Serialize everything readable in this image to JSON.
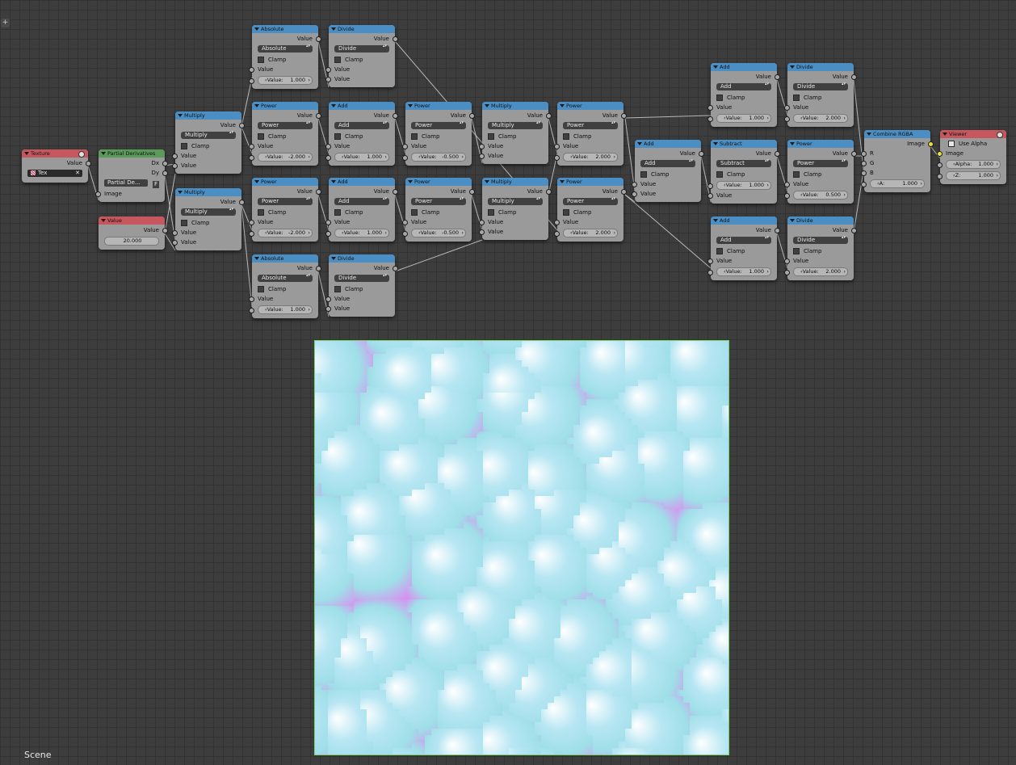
{
  "editor": {
    "add_button": "+",
    "scene_label": "Scene"
  },
  "nodes": {
    "texture": {
      "title": "Texture",
      "out_value": "Value",
      "tex_name": "Tex",
      "tex_clear": "✕"
    },
    "partial": {
      "title": "Partial Derivatives",
      "out_dx": "Dx",
      "out_dy": "Dy",
      "img_name": "Partial De...",
      "fake_user": "F",
      "in_image": "Image"
    },
    "value": {
      "title": "Value",
      "out_value": "Value",
      "value": "20.000"
    },
    "mul_a": {
      "title": "Multiply",
      "out": "Value",
      "op": "Multiply",
      "clamp": "Clamp",
      "in1": "Value",
      "in2": "Value"
    },
    "mul_b": {
      "title": "Multiply",
      "out": "Value",
      "op": "Multiply",
      "clamp": "Clamp",
      "in1": "Value",
      "in2": "Value"
    },
    "abs_a": {
      "title": "Absolute",
      "out": "Value",
      "op": "Absolute",
      "clamp": "Clamp",
      "in1": "Value",
      "field_label": "Value:",
      "field_value": "1.000"
    },
    "pow_a": {
      "title": "Power",
      "out": "Value",
      "op": "Power",
      "clamp": "Clamp",
      "in1": "Value",
      "field_label": "Value:",
      "field_value": "-2.000"
    },
    "pow_b": {
      "title": "Power",
      "out": "Value",
      "op": "Power",
      "clamp": "Clamp",
      "in1": "Value",
      "field_label": "Value:",
      "field_value": "-2.000"
    },
    "abs_b": {
      "title": "Absolute",
      "out": "Value",
      "op": "Absolute",
      "clamp": "Clamp",
      "in1": "Value",
      "field_label": "Value:",
      "field_value": "1.000"
    },
    "div_a": {
      "title": "Divide",
      "out": "Value",
      "op": "Divide",
      "clamp": "Clamp",
      "in1": "Value",
      "in2": "Value"
    },
    "add_a": {
      "title": "Add",
      "out": "Value",
      "op": "Add",
      "clamp": "Clamp",
      "in1": "Value",
      "field_label": "Value:",
      "field_value": "1.000"
    },
    "add_b": {
      "title": "Add",
      "out": "Value",
      "op": "Add",
      "clamp": "Clamp",
      "in1": "Value",
      "field_label": "Value:",
      "field_value": "1.000"
    },
    "div_b": {
      "title": "Divide",
      "out": "Value",
      "op": "Divide",
      "clamp": "Clamp",
      "in1": "Value",
      "in2": "Value"
    },
    "pow_c": {
      "title": "Power",
      "out": "Value",
      "op": "Power",
      "clamp": "Clamp",
      "in1": "Value",
      "field_label": "Value:",
      "field_value": "-0.500"
    },
    "pow_d": {
      "title": "Power",
      "out": "Value",
      "op": "Power",
      "clamp": "Clamp",
      "in1": "Value",
      "field_label": "Value:",
      "field_value": "-0.500"
    },
    "mul_c": {
      "title": "Multiply",
      "out": "Value",
      "op": "Multiply",
      "clamp": "Clamp",
      "in1": "Value",
      "in2": "Value"
    },
    "mul_d": {
      "title": "Multiply",
      "out": "Value",
      "op": "Multiply",
      "clamp": "Clamp",
      "in1": "Value",
      "in2": "Value"
    },
    "pow_e": {
      "title": "Power",
      "out": "Value",
      "op": "Power",
      "clamp": "Clamp",
      "in1": "Value",
      "field_label": "Value:",
      "field_value": "2.000"
    },
    "pow_f": {
      "title": "Power",
      "out": "Value",
      "op": "Power",
      "clamp": "Clamp",
      "in1": "Value",
      "field_label": "Value:",
      "field_value": "2.000"
    },
    "add_c": {
      "title": "Add",
      "out": "Value",
      "op": "Add",
      "clamp": "Clamp",
      "in1": "Value",
      "in2": "Value"
    },
    "add_d": {
      "title": "Add",
      "out": "Value",
      "op": "Add",
      "clamp": "Clamp",
      "in1": "Value",
      "field_label": "Value:",
      "field_value": "1.000"
    },
    "sub_a": {
      "title": "Subtract",
      "out": "Value",
      "op": "Subtract",
      "clamp": "Clamp",
      "field_label": "Value:",
      "field_value": "1.000",
      "in2": "Value"
    },
    "add_e": {
      "title": "Add",
      "out": "Value",
      "op": "Add",
      "clamp": "Clamp",
      "in1": "Value",
      "field_label": "Value:",
      "field_value": "1.000"
    },
    "div_c": {
      "title": "Divide",
      "out": "Value",
      "op": "Divide",
      "clamp": "Clamp",
      "in1": "Value",
      "field_label": "Value:",
      "field_value": "2.000"
    },
    "pow_g": {
      "title": "Power",
      "out": "Value",
      "op": "Power",
      "clamp": "Clamp",
      "in1": "Value",
      "field_label": "Value:",
      "field_value": "0.500"
    },
    "div_d": {
      "title": "Divide",
      "out": "Value",
      "op": "Divide",
      "clamp": "Clamp",
      "in1": "Value",
      "field_label": "Value:",
      "field_value": "2.000"
    },
    "combine": {
      "title": "Combine RGBA",
      "out": "Image",
      "r": "R",
      "g": "G",
      "b": "B",
      "a_label": "A:",
      "a_value": "1.000"
    },
    "viewer": {
      "title": "Viewer",
      "use_alpha": "Use Alpha",
      "in_image": "Image",
      "alpha_label": "Alpha:",
      "alpha_value": "1.000",
      "z_label": "Z:",
      "z_value": "1.000"
    }
  },
  "colors": {
    "header_math": "#4a8ec4",
    "header_input": "#c6575e",
    "header_converter": "#5c9a5a",
    "node_body": "#9a9a9a",
    "grid": "#3d3d3d",
    "socket_color": "#e8e03a"
  }
}
